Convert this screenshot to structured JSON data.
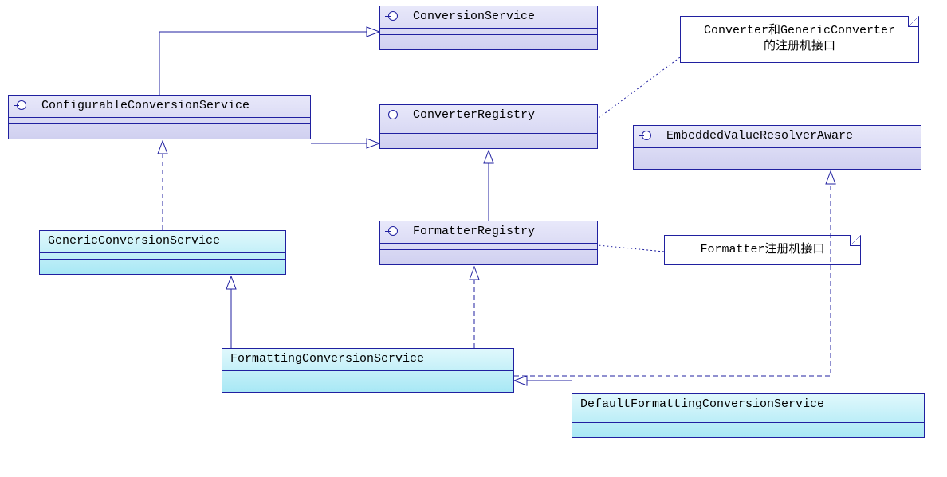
{
  "diagram": {
    "elements": {
      "conversionService": {
        "name": "ConversionService",
        "kind": "interface"
      },
      "configurableConversionService": {
        "name": "ConfigurableConversionService",
        "kind": "interface"
      },
      "converterRegistry": {
        "name": "ConverterRegistry",
        "kind": "interface"
      },
      "embeddedValueResolverAware": {
        "name": "EmbeddedValueResolverAware",
        "kind": "interface"
      },
      "formatterRegistry": {
        "name": "FormatterRegistry",
        "kind": "interface"
      },
      "genericConversionService": {
        "name": "GenericConversionService",
        "kind": "class"
      },
      "formattingConversionService": {
        "name": "FormattingConversionService",
        "kind": "class"
      },
      "defaultFormattingConversionService": {
        "name": "DefaultFormattingConversionService",
        "kind": "class"
      }
    },
    "notes": {
      "note1_line1": "Converter和GenericConverter",
      "note1_line2": "的注册机接口",
      "note2": "Formatter注册机接口"
    },
    "relationships": [
      {
        "from": "ConfigurableConversionService",
        "to": "ConversionService",
        "type": "generalization"
      },
      {
        "from": "ConfigurableConversionService",
        "to": "ConverterRegistry",
        "type": "generalization"
      },
      {
        "from": "FormatterRegistry",
        "to": "ConverterRegistry",
        "type": "generalization"
      },
      {
        "from": "GenericConversionService",
        "to": "ConfigurableConversionService",
        "type": "realization"
      },
      {
        "from": "FormattingConversionService",
        "to": "GenericConversionService",
        "type": "generalization"
      },
      {
        "from": "FormattingConversionService",
        "to": "FormatterRegistry",
        "type": "realization"
      },
      {
        "from": "FormattingConversionService",
        "to": "EmbeddedValueResolverAware",
        "type": "realization"
      },
      {
        "from": "DefaultFormattingConversionService",
        "to": "FormattingConversionService",
        "type": "generalization"
      },
      {
        "from": "note1",
        "to": "ConverterRegistry",
        "type": "anchor"
      },
      {
        "from": "note2",
        "to": "FormatterRegistry",
        "type": "anchor"
      }
    ]
  }
}
